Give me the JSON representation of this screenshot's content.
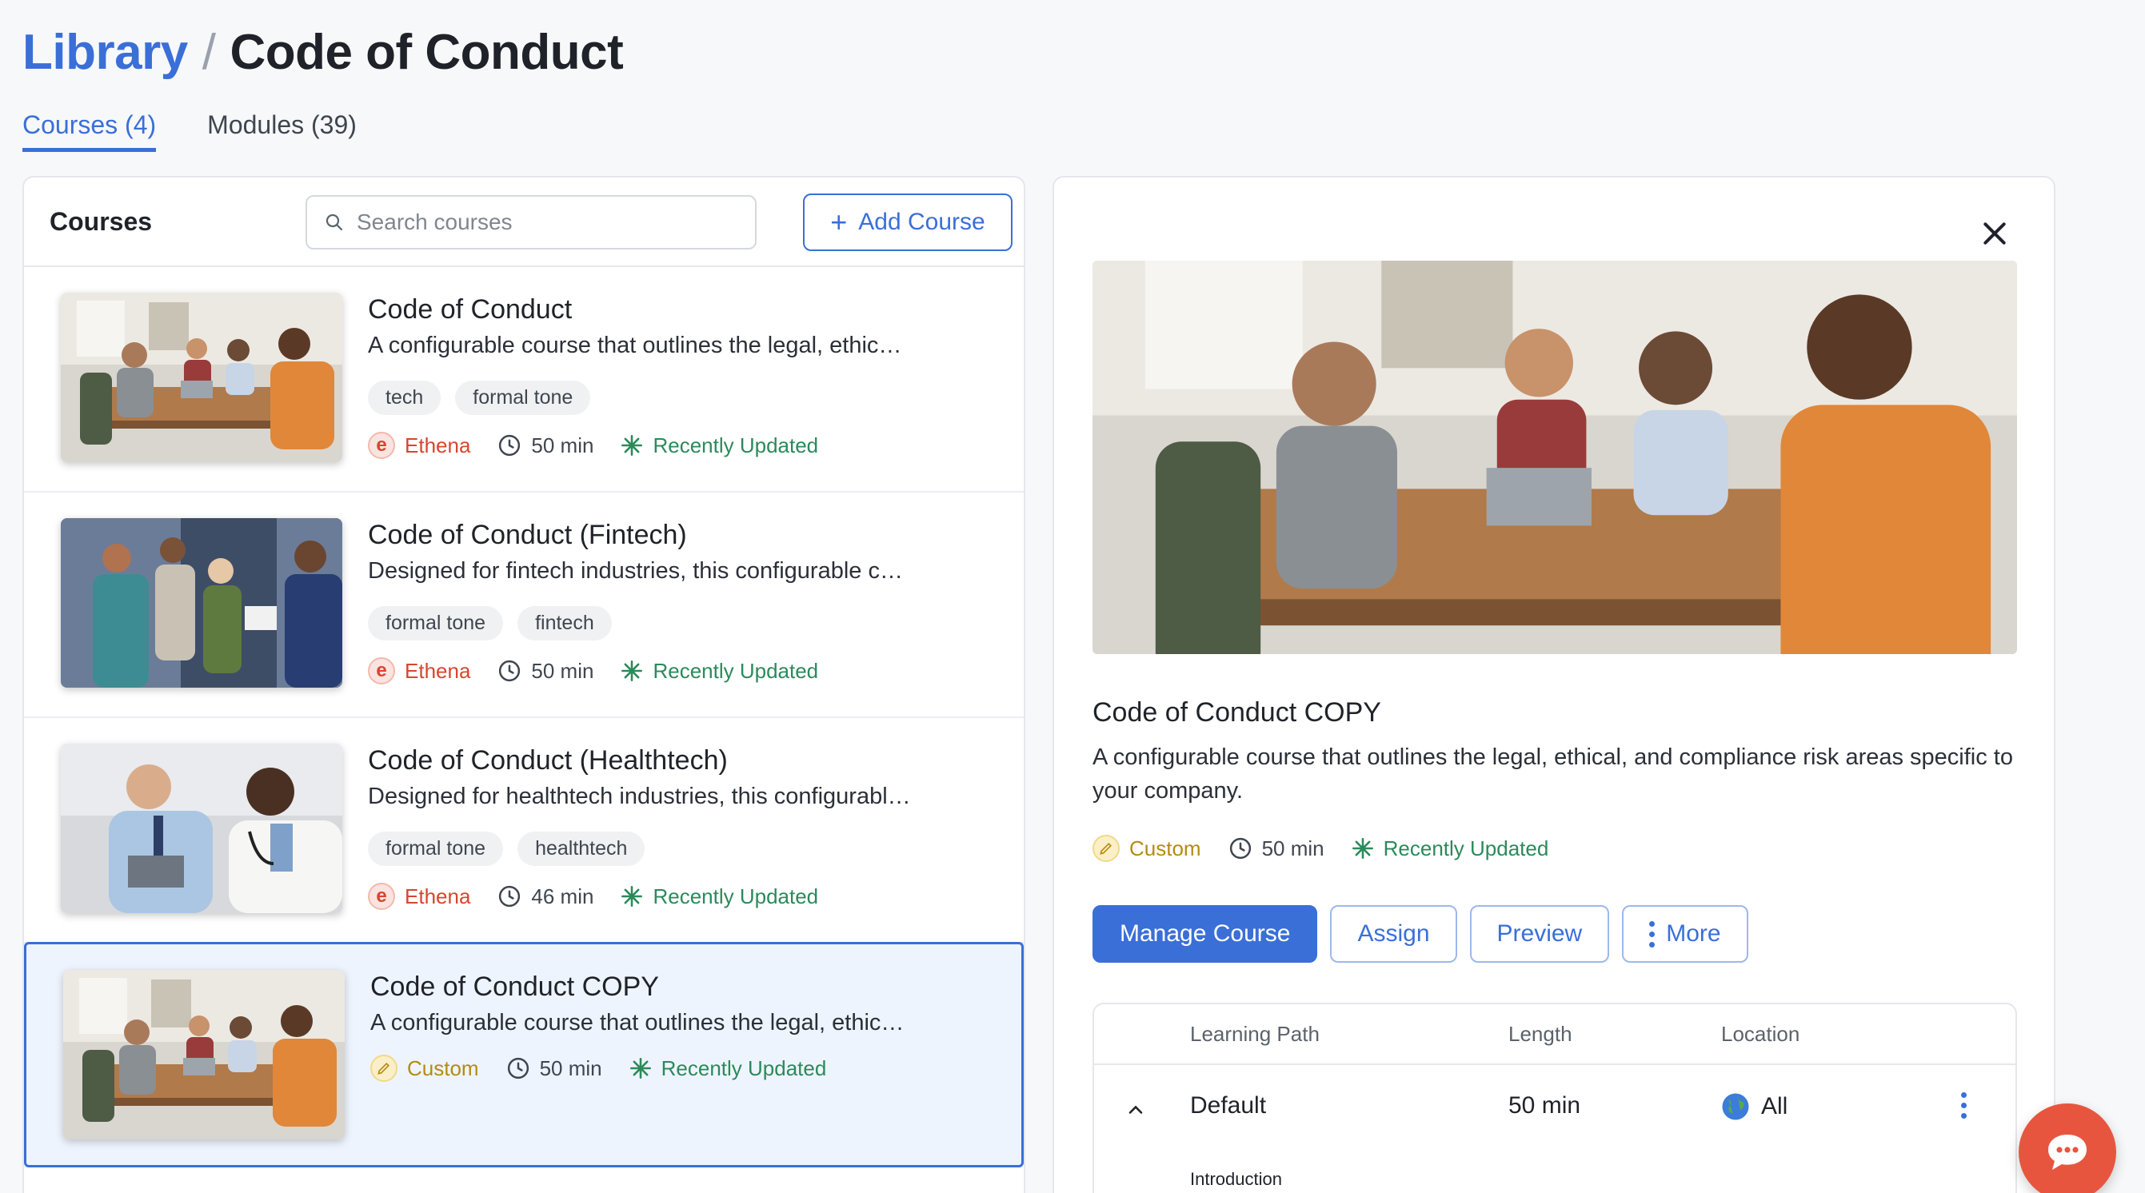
{
  "breadcrumb": {
    "library": "Library",
    "separator": "/",
    "current": "Code of Conduct"
  },
  "tabs": [
    {
      "label": "Courses (4)",
      "active": true
    },
    {
      "label": "Modules (39)",
      "active": false
    }
  ],
  "courses_panel": {
    "title": "Courses",
    "search_placeholder": "Search courses",
    "add_button": "Add Course",
    "items": [
      {
        "title": "Code of Conduct",
        "description": "A configurable course that outlines the legal, ethic…",
        "tags": [
          "tech",
          "formal tone"
        ],
        "author": "Ethena",
        "author_icon": "ethena-logo-icon",
        "duration": "50 min",
        "status": "Recently Updated"
      },
      {
        "title": "Code of Conduct (Fintech)",
        "description": "Designed for fintech industries, this configurable c…",
        "tags": [
          "formal tone",
          "fintech"
        ],
        "author": "Ethena",
        "author_icon": "ethena-logo-icon",
        "duration": "50 min",
        "status": "Recently Updated"
      },
      {
        "title": "Code of Conduct (Healthtech)",
        "description": "Designed for healthtech industries, this configurabl…",
        "tags": [
          "formal tone",
          "healthtech"
        ],
        "author": "Ethena",
        "author_icon": "ethena-logo-icon",
        "duration": "46 min",
        "status": "Recently Updated"
      },
      {
        "title": "Code of Conduct COPY",
        "description": "A configurable course that outlines the legal, ethic…",
        "tags": [],
        "author": "Custom",
        "author_icon": "pencil-icon",
        "duration": "50 min",
        "status": "Recently Updated",
        "selected": true
      }
    ]
  },
  "detail": {
    "title": "Code of Conduct COPY",
    "description": "A configurable course that outlines the legal, ethical, and compliance risk areas specific to your company.",
    "author": "Custom",
    "duration": "50 min",
    "status": "Recently Updated",
    "actions": {
      "manage": "Manage Course",
      "assign": "Assign",
      "preview": "Preview",
      "more": "More"
    },
    "learning_paths": {
      "columns": {
        "path": "Learning Path",
        "length": "Length",
        "location": "Location"
      },
      "rows": [
        {
          "path": "Default",
          "length": "50 min",
          "location": "All",
          "expanded": true
        }
      ],
      "sub_item": "Introduction"
    }
  },
  "colors": {
    "accent": "#3a6fd8",
    "ethena": "#d7462f",
    "updated": "#2b8a5a",
    "custom": "#b58b13",
    "chat": "#e8553f"
  }
}
